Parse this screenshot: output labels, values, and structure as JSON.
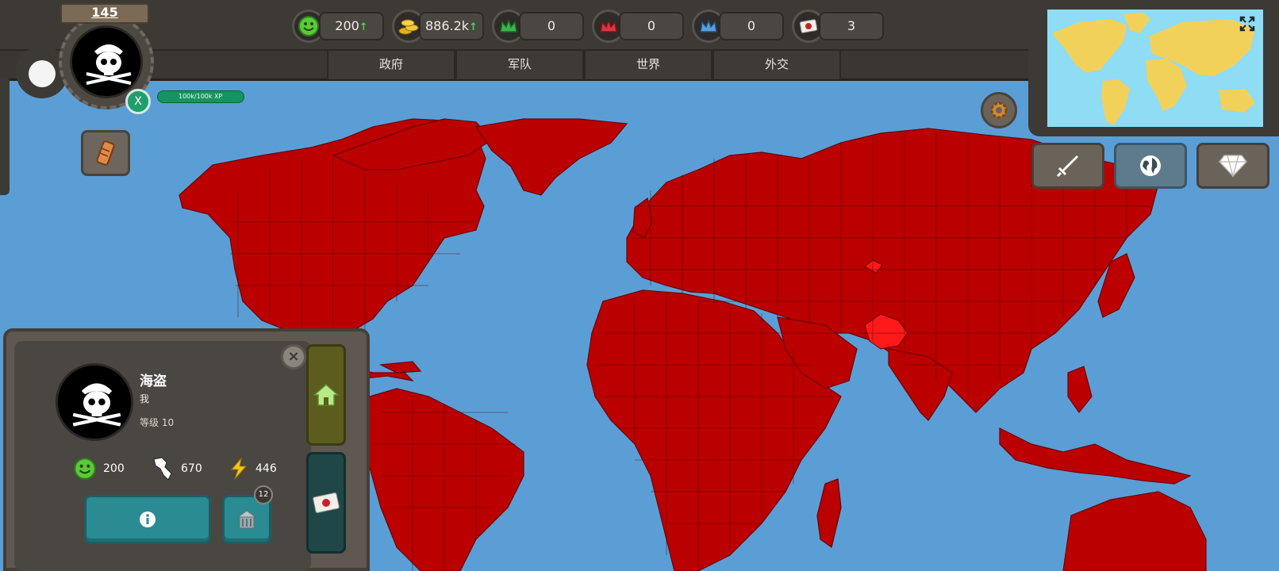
{
  "colors": {
    "territory": "#bb0000",
    "ocean": "#5b9ed6",
    "minimap_land": "#f2d15a",
    "minimap_sea": "#8fdcf5",
    "panel_bg": "#4a4641"
  },
  "resources": [
    {
      "id": "happiness",
      "icon": "smiley-icon",
      "value": "200",
      "trend": "↑"
    },
    {
      "id": "gold",
      "icon": "gold-coins-icon",
      "value": "886.2k",
      "trend": "↑"
    },
    {
      "id": "green_crown",
      "icon": "crown-green-icon",
      "value": "0"
    },
    {
      "id": "red_crown",
      "icon": "crown-red-icon",
      "value": "0"
    },
    {
      "id": "blue_crown",
      "icon": "crown-blue-icon",
      "value": "0"
    },
    {
      "id": "letters",
      "icon": "letter-icon",
      "value": "3"
    }
  ],
  "menu": [
    "政府",
    "军队",
    "世界",
    "外交"
  ],
  "player": {
    "level_badge": "145",
    "xp_text": "100k/100k XP",
    "x_button": "X"
  },
  "panel": {
    "name": "海盗",
    "subtitle": "我",
    "level": "等级 10",
    "stats": [
      {
        "icon": "smiley-icon",
        "value": "200"
      },
      {
        "icon": "territory-icon",
        "value": "670"
      },
      {
        "icon": "lightning-icon",
        "value": "446"
      }
    ],
    "badge_count": "12"
  }
}
